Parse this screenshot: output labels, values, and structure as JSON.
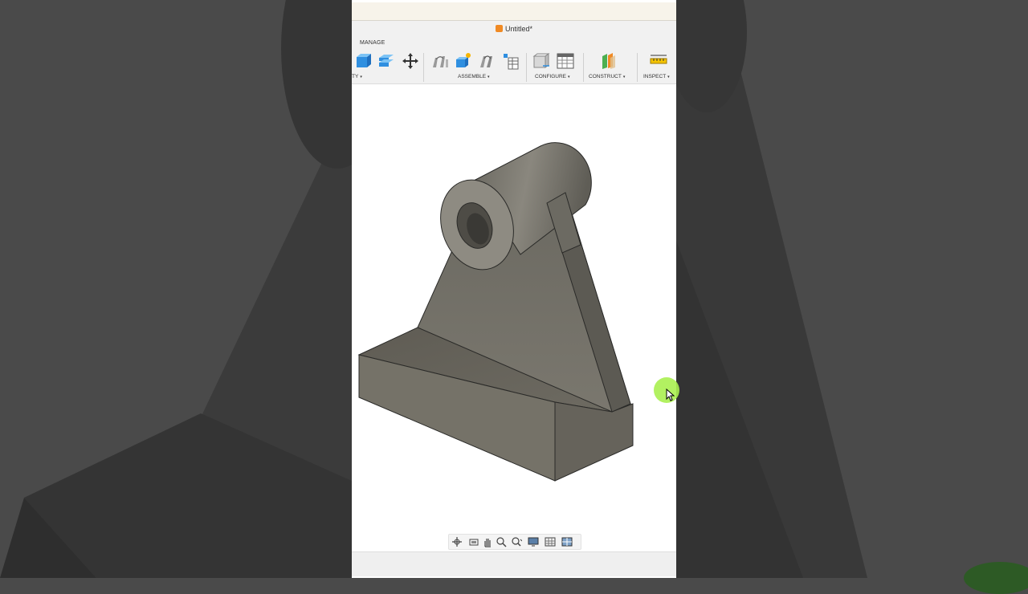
{
  "window": {
    "title": "Untitled*"
  },
  "ribbon": {
    "tab_label": "MANAGE",
    "groups": [
      {
        "label": "TY",
        "has_dropdown": true
      },
      {
        "label": "ASSEMBLE",
        "has_dropdown": true
      },
      {
        "label": "CONFIGURE",
        "has_dropdown": true
      },
      {
        "label": "CONSTRUCT",
        "has_dropdown": true
      },
      {
        "label": "INSPECT",
        "has_dropdown": true
      }
    ],
    "dropdown_glyph": "▾"
  },
  "icons": {
    "modify_tools": [
      "box-icon",
      "stack-icon",
      "move-icon"
    ],
    "assemble_tools": [
      "joint-icon",
      "new-component-icon",
      "rigid-joint-icon",
      "table-icon"
    ],
    "configure_tools": [
      "configure-icon",
      "configure-table-icon"
    ],
    "construct_tools": [
      "plane-icon"
    ],
    "inspect_tools": [
      "measure-icon"
    ],
    "navigation": [
      "orbit-icon",
      "look-at-icon",
      "pan-icon",
      "zoom-icon",
      "fit-icon",
      "display-icon",
      "grid-icon",
      "viewports-icon"
    ]
  },
  "colors": {
    "accent_orange": "#f08a24",
    "part_gray": "#6e6c64",
    "cursor_highlight": "#aaf050"
  }
}
